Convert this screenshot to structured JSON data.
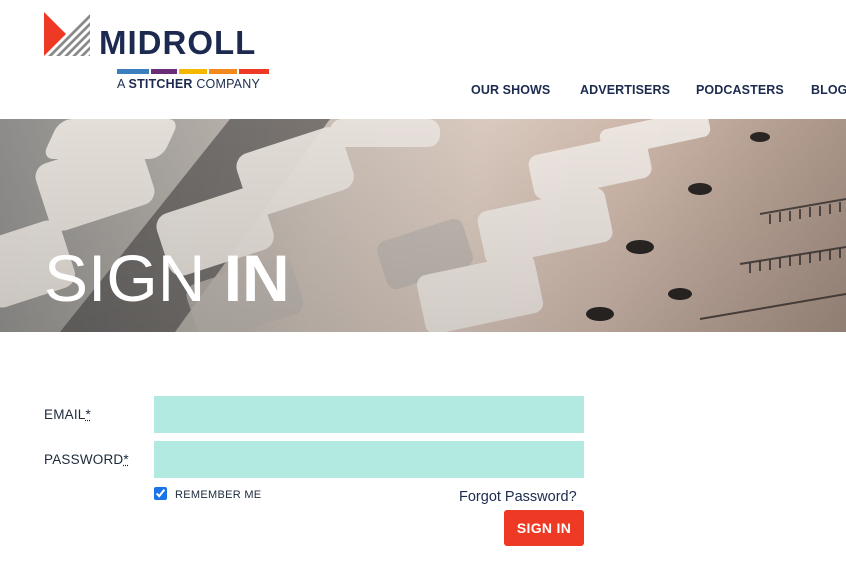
{
  "brand": {
    "name": "MIDROLL",
    "tagline_prefix": "A ",
    "tagline_bold": "STITCHER",
    "tagline_suffix": " COMPANY",
    "colors": {
      "navy": "#1b2a4e",
      "red": "#ee3a25",
      "purple": "#6b2c7a",
      "yellow": "#f5b800",
      "orange": "#f08a1d",
      "blue": "#3a7ec0"
    }
  },
  "nav": {
    "items": [
      {
        "label": "OUR SHOWS"
      },
      {
        "label": "ADVERTISERS"
      },
      {
        "label": "PODCASTERS"
      },
      {
        "label": "BLOG"
      }
    ]
  },
  "hero": {
    "title_light": "SIGN ",
    "title_bold": "IN"
  },
  "form": {
    "email_label": "EMAIL",
    "password_label": "PASSWORD",
    "required_marker": "*",
    "email_value": "",
    "password_value": "",
    "remember_label": "REMEMBER ME",
    "remember_checked": true,
    "forgot_label": "Forgot Password?",
    "submit_label": "SIGN IN",
    "input_color": "#b2e9e0"
  }
}
